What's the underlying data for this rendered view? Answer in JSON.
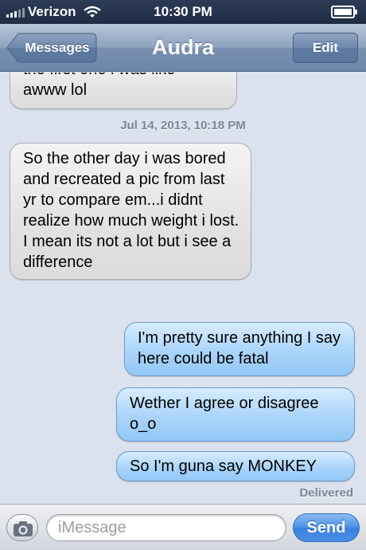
{
  "status_bar": {
    "carrier": "Verizon",
    "time": "10:30 PM",
    "signal_icon": "signal-bars-icon",
    "wifi_icon": "wifi-icon",
    "battery_icon": "battery-icon"
  },
  "nav": {
    "back_label": "Messages",
    "title": "Audra",
    "edit_label": "Edit"
  },
  "thread": {
    "partial_message": {
      "line1": "the first one i was like",
      "line2": "awww lol"
    },
    "timestamp": "Jul 14, 2013, 10:18 PM",
    "messages": [
      {
        "from": "contact",
        "text": "So the other day i was bored and recreated a pic from last yr to compare em...i didnt realize how much weight i lost. I mean its not a lot but i see a difference"
      },
      {
        "from": "me",
        "text": "I'm pretty sure anything I say here could be fatal"
      },
      {
        "from": "me",
        "text": "Wether I agree or disagree o_o"
      },
      {
        "from": "me",
        "text": "So I'm guna say MONKEY"
      }
    ],
    "delivered_label": "Delivered"
  },
  "input_bar": {
    "camera_icon": "camera-icon",
    "placeholder": "iMessage",
    "value": "",
    "send_label": "Send"
  },
  "colors": {
    "incoming_bubble": "#e2e2e2",
    "outgoing_bubble": "#aad4fb",
    "nav_bar": "#7990b0",
    "send_button": "#3a7fdc",
    "background": "#dbe2ed"
  }
}
